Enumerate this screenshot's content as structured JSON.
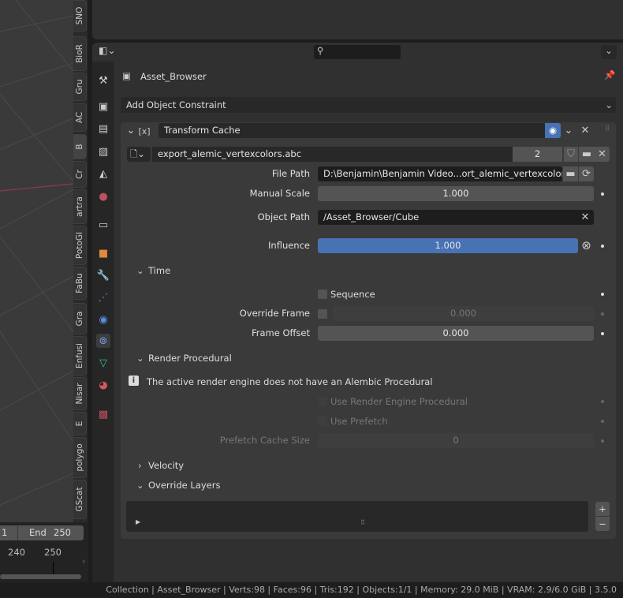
{
  "viewport_tabs": [
    "SNO",
    "BioR",
    "Gru",
    "AC",
    "B",
    "Cr",
    "artra",
    "PotoGI",
    "FaBu",
    "Gra",
    "Enfusi",
    "Nisar",
    "E",
    "polygo",
    "GScat"
  ],
  "timeline": {
    "start": "1",
    "end_label": "End",
    "end": "250",
    "ticks": [
      "240",
      "250"
    ]
  },
  "properties": {
    "object_name": "Asset_Browser",
    "add_constraint": "Add Object Constraint",
    "constraint": {
      "name": "Transform Cache",
      "cache_file": "export_alemic_vertexcolors.abc",
      "users": "2",
      "file_path_label": "File Path",
      "file_path": "D:\\Benjamin\\Benjamin Video...ort_alemic_vertexcolors.abc",
      "manual_scale_label": "Manual Scale",
      "manual_scale": "1.000",
      "object_path_label": "Object Path",
      "object_path": "/Asset_Browser/Cube",
      "influence_label": "Influence",
      "influence": "1.000",
      "influence_fraction": 1.0
    },
    "time": {
      "title": "Time",
      "sequence": "Sequence",
      "override_frame_label": "Override Frame",
      "override_frame": "0.000",
      "frame_offset_label": "Frame Offset",
      "frame_offset": "0.000"
    },
    "render_procedural": {
      "title": "Render Procedural",
      "info": "The active render engine does not have an Alembic Procedural",
      "use_procedural": "Use Render Engine Procedural",
      "use_prefetch": "Use Prefetch",
      "prefetch_label": "Prefetch Cache Size",
      "prefetch": "0"
    },
    "velocity": {
      "title": "Velocity"
    },
    "override_layers": {
      "title": "Override Layers",
      "add": "+",
      "remove": "−"
    }
  },
  "status_bar": "Collection | Asset_Browser | Verts:98 | Faces:96 | Tris:192 | Objects:1/1 | Memory: 29.0 MiB | VRAM: 2.9/6.0 GiB | 3.5.0",
  "colors": {
    "accent": "#4772b3",
    "panel": "#3a3a3a",
    "field": "#1d1d1d"
  }
}
